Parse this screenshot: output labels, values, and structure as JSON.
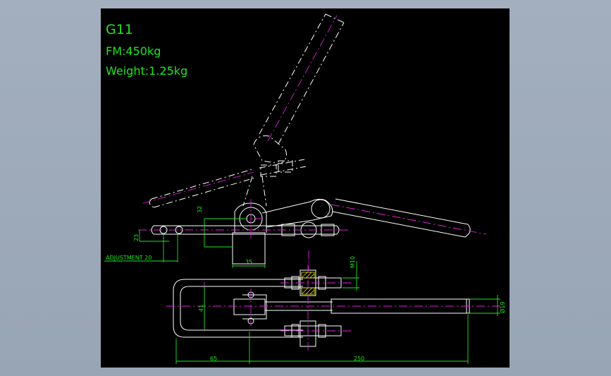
{
  "drawing": {
    "title": "G11",
    "force_label": "FM:450kg",
    "weight_label": "Weight:1.25kg"
  },
  "dimensions": {
    "d32": "32",
    "d23": "23",
    "adjustment": "ADJUSTMENT 20",
    "d35": "35",
    "m10": "M10",
    "d41": "41",
    "d19": "Ø19",
    "d65": "65",
    "d250": "250"
  },
  "colors": {
    "background": "#000000",
    "geometry": "#ffffff",
    "dimension": "#1ee61e",
    "centerline": "#e01ee0",
    "hatch": "#e8e800"
  }
}
